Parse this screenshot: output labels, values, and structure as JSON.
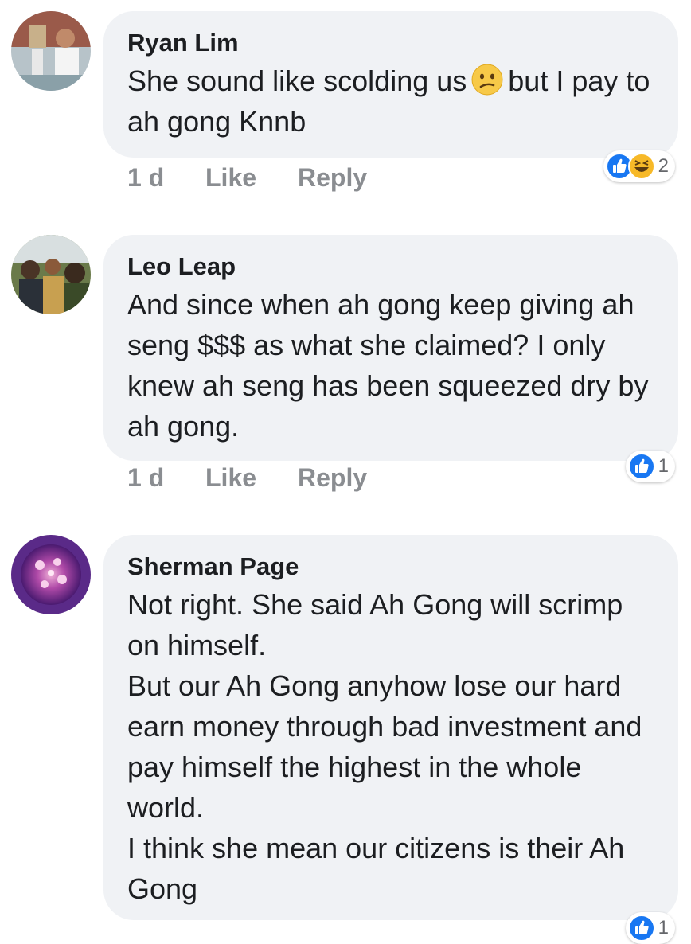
{
  "comments": [
    {
      "author": "Ryan Lim",
      "text_before_emoji": "She sound like scolding us",
      "emoji": "confused-face",
      "text_after_emoji": "but I pay to ah gong Knnb",
      "time": "1 d",
      "like_label": "Like",
      "reply_label": "Reply",
      "reactions": [
        "like",
        "haha"
      ],
      "reaction_count": "2"
    },
    {
      "author": "Leo Leap",
      "text": "And since when ah gong keep giving ah seng $$$ as what she claimed? I only knew ah seng has been squeezed dry by ah gong.",
      "time": "1 d",
      "like_label": "Like",
      "reply_label": "Reply",
      "reactions": [
        "like"
      ],
      "reaction_count": "1"
    },
    {
      "author": "Sherman Page",
      "text": "Not right. She said Ah Gong will scrimp on himself.\nBut our Ah Gong anyhow lose our hard earn money through bad investment and pay himself the highest in the whole world.\nI think she mean our citizens is their Ah Gong",
      "reactions": [
        "like"
      ],
      "reaction_count": "1"
    }
  ],
  "colors": {
    "bubble": "#f0f2f5",
    "meta": "#8a8d91",
    "like_blue": "#1877f2",
    "haha_yellow": "#f7b928"
  }
}
